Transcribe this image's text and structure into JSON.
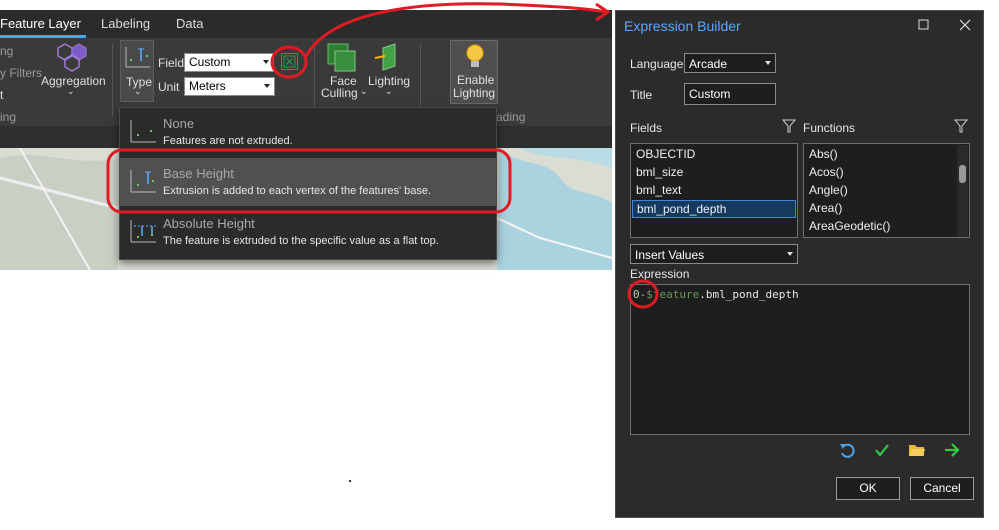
{
  "ribbon": {
    "tabs": [
      {
        "label": "Feature Layer",
        "active": true
      },
      {
        "label": "Labeling",
        "active": false
      },
      {
        "label": "Data",
        "active": false
      }
    ],
    "partial_left_1": "ng",
    "partial_left_2": "y Filters",
    "partial_left_3": "t",
    "partial_left_4": "ing",
    "aggregation_label": "Aggregation",
    "type_label": "Type",
    "field_label": "Field",
    "field_value": "Custom",
    "unit_label": "Unit",
    "unit_value": "Meters",
    "face_culling_label_1": "Face",
    "face_culling_label_2": "Culling",
    "lighting_label": "Lighting",
    "enable_lighting_1": "Enable",
    "enable_lighting_2": "Lighting",
    "group_partial": "ading"
  },
  "type_menu": {
    "items": [
      {
        "title": "None",
        "description": "Features are not extruded.",
        "highlighted": false
      },
      {
        "title": "Base Height",
        "description": "Extrusion is added to each vertex of the features' base.",
        "highlighted": true
      },
      {
        "title": "Absolute Height",
        "description": "The feature is extruded to the specific value as a flat top.",
        "highlighted": false
      }
    ]
  },
  "dialog": {
    "title": "Expression Builder",
    "language_label": "Language",
    "language_value": "Arcade",
    "title_label": "Title",
    "title_value": "Custom",
    "fields_label": "Fields",
    "functions_label": "Functions",
    "fields": [
      "OBJECTID",
      "bml_size",
      "bml_text",
      "bml_pond_depth"
    ],
    "selected_field": "bml_pond_depth",
    "functions": [
      "Abs()",
      "Acos()",
      "Angle()",
      "Area()",
      "AreaGeodetic()"
    ],
    "insert_values_label": "Insert Values",
    "expression_label": "Expression",
    "expression": {
      "number": "0-",
      "variable": "$feature",
      "rest": ".bml_pond_depth"
    },
    "ok_label": "OK",
    "cancel_label": "Cancel"
  },
  "colors": {
    "accent_blue": "#3fa9f5",
    "title_blue": "#5aa8ff",
    "annotation_red": "#e01b24",
    "ok_green": "#2ecc40",
    "folder_yellow": "#e8b43a"
  }
}
